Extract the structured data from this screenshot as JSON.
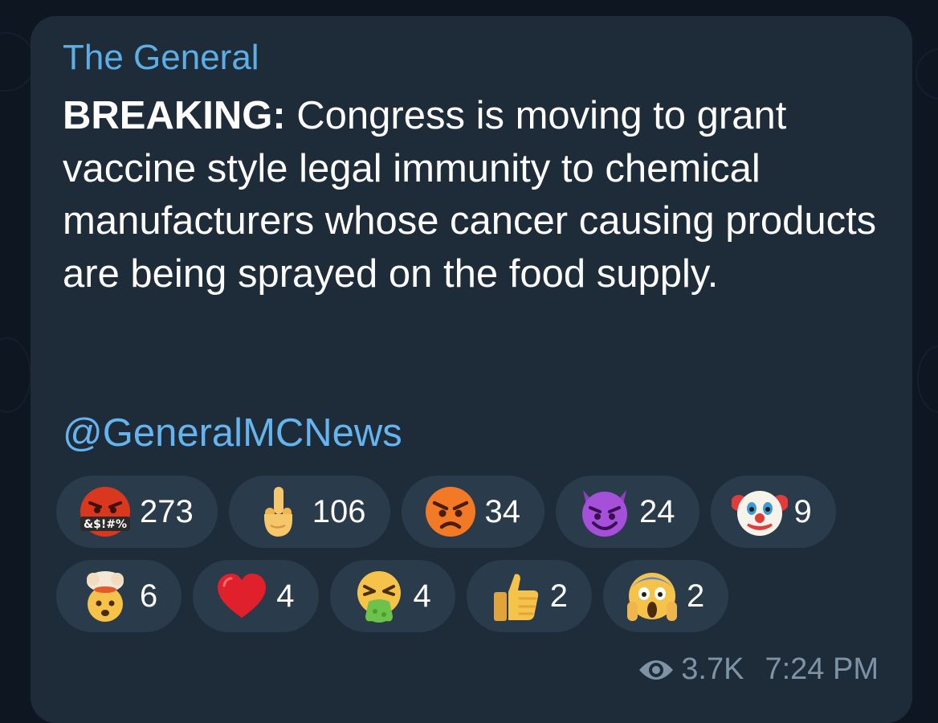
{
  "message": {
    "sender": "The General",
    "text_bold": "BREAKING:",
    "text_body": " Congress is moving to grant vaccine style legal immunity to chemical manufacturers whose cancer causing products are being sprayed on the food supply.",
    "handle": "@GeneralMCNews"
  },
  "reactions": {
    "row1": [
      {
        "icon": "face-with-symbols-on-mouth-icon",
        "count": "273"
      },
      {
        "icon": "middle-finger-icon",
        "count": "106"
      },
      {
        "icon": "angry-face-icon",
        "count": "34"
      },
      {
        "icon": "smiling-face-with-horns-icon",
        "count": "24"
      },
      {
        "icon": "clown-face-icon",
        "count": "9"
      }
    ],
    "row2": [
      {
        "icon": "exploding-head-icon",
        "count": "6"
      },
      {
        "icon": "red-heart-icon",
        "count": "4"
      },
      {
        "icon": "face-vomiting-icon",
        "count": "4"
      },
      {
        "icon": "thumbs-up-icon",
        "count": "2"
      },
      {
        "icon": "face-screaming-in-fear-icon",
        "count": "2"
      }
    ]
  },
  "meta": {
    "views": "3.7K",
    "time": "7:24 PM"
  },
  "colors": {
    "background": "#0e1621",
    "bubble": "#1e2c3a",
    "reaction_pill": "#2a3b4c",
    "sender_name": "#5eaee6",
    "link": "#66b4ee",
    "meta_text": "#7f93a6"
  }
}
